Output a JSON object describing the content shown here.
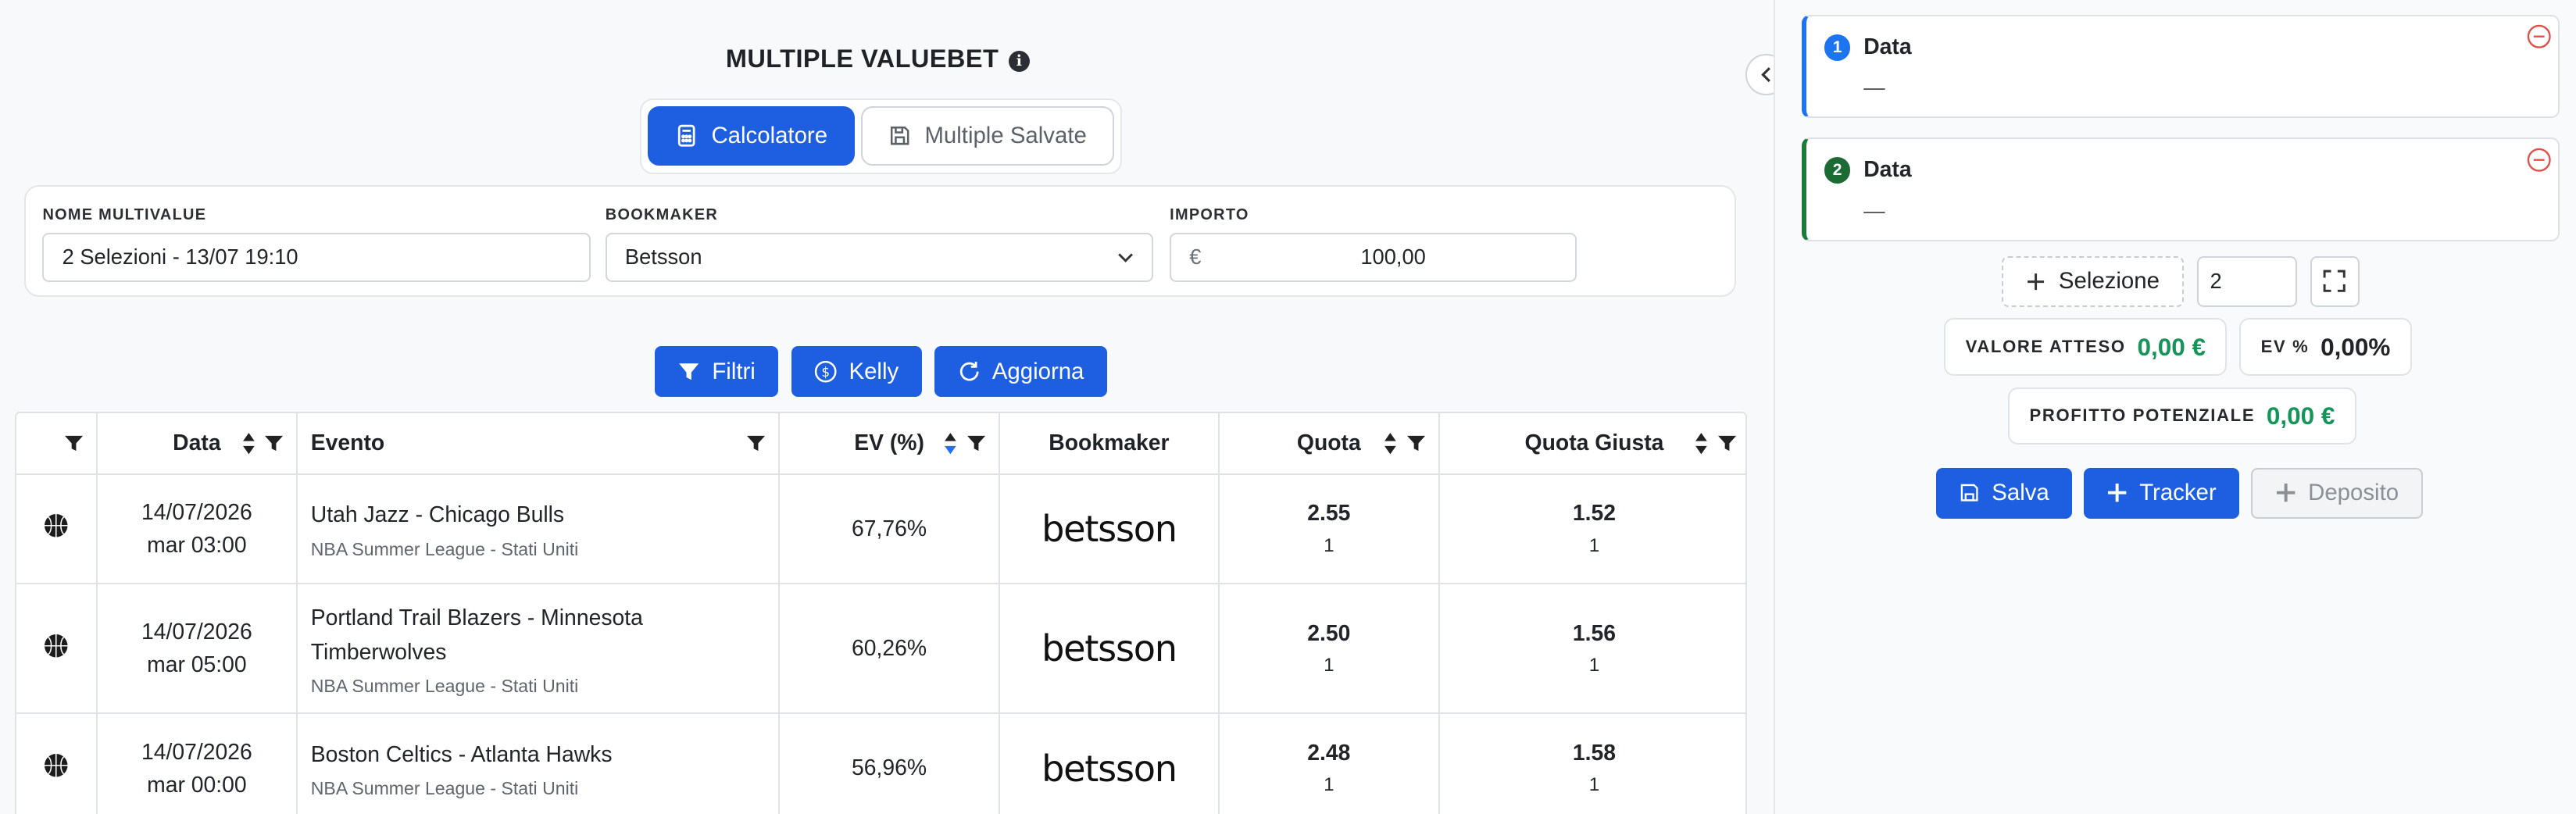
{
  "header": {
    "title": "MULTIPLE VALUEBET",
    "info_icon": "i"
  },
  "tabs": [
    {
      "label": "Calcolatore",
      "icon": "calculator-icon",
      "active": true
    },
    {
      "label": "Multiple Salvate",
      "icon": "save-icon",
      "active": false
    }
  ],
  "form": {
    "name_label": "NOME MULTIVALUE",
    "name_value": "2 Selezioni - 13/07 19:10",
    "bookmaker_label": "BOOKMAKER",
    "bookmaker_value": "Betsson",
    "amount_label": "IMPORTO",
    "amount_currency": "€",
    "amount_value": "100,00"
  },
  "actions": {
    "filters": "Filtri",
    "kelly": "Kelly",
    "refresh": "Aggiorna"
  },
  "table": {
    "columns": [
      "Data",
      "Evento",
      "EV (%)",
      "Bookmaker",
      "Quota",
      "Quota Giusta"
    ],
    "rows": [
      {
        "sport": "basketball",
        "date": "14/07/2026",
        "time": "mar 03:00",
        "event": "Utah Jazz - Chicago Bulls",
        "league": "NBA Summer League - Stati Uniti",
        "ev": "67,76%",
        "bookmaker": "betsson",
        "odd": "2.55",
        "odd_sel": "1",
        "fair": "1.52",
        "fair_sel": "1"
      },
      {
        "sport": "basketball",
        "date": "14/07/2026",
        "time": "mar 05:00",
        "event": "Portland Trail Blazers - Minnesota Timberwolves",
        "league": "NBA Summer League - Stati Uniti",
        "ev": "60,26%",
        "bookmaker": "betsson",
        "odd": "2.50",
        "odd_sel": "1",
        "fair": "1.56",
        "fair_sel": "1"
      },
      {
        "sport": "basketball",
        "date": "14/07/2026",
        "time": "mar 00:00",
        "event": "Boston Celtics - Atlanta Hawks",
        "league": "NBA Summer League - Stati Uniti",
        "ev": "56,96%",
        "bookmaker": "betsson",
        "odd": "2.48",
        "odd_sel": "1",
        "fair": "1.58",
        "fair_sel": "1"
      }
    ]
  },
  "sidebar": {
    "selections": [
      {
        "num": "1",
        "title": "Data",
        "value": "—"
      },
      {
        "num": "2",
        "title": "Data",
        "value": "—"
      }
    ],
    "add_selection": "Selezione",
    "count": "2",
    "expected_value_label": "VALORE ATTESO",
    "expected_value": "0,00 €",
    "ev_label": "EV %",
    "ev_value": "0,00%",
    "profit_label": "PROFITTO POTENZIALE",
    "profit_value": "0,00 €",
    "save": "Salva",
    "tracker": "Tracker",
    "deposit": "Deposito"
  }
}
